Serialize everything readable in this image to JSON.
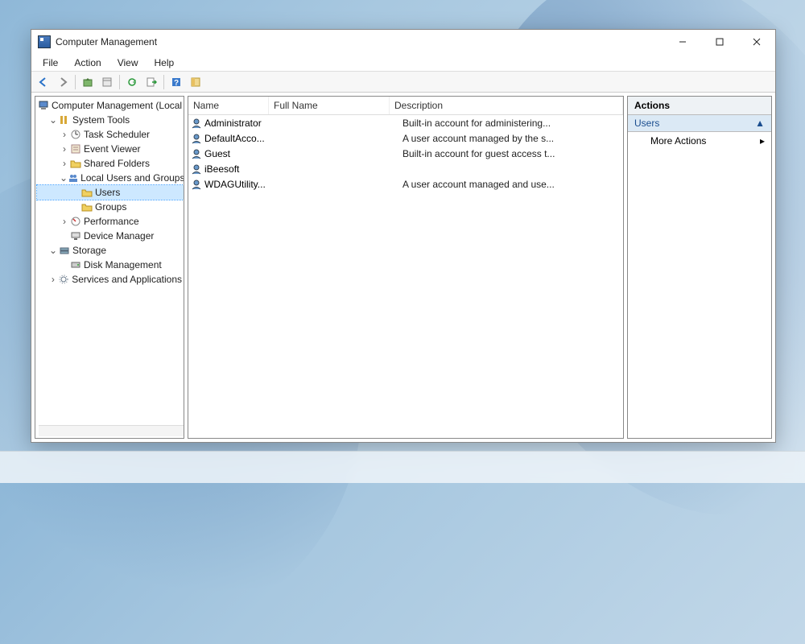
{
  "window": {
    "title": "Computer Management"
  },
  "menubar": [
    "File",
    "Action",
    "View",
    "Help"
  ],
  "tree": {
    "root": "Computer Management (Local",
    "system_tools": "System Tools",
    "task_scheduler": "Task Scheduler",
    "event_viewer": "Event Viewer",
    "shared_folders": "Shared Folders",
    "local_users_groups": "Local Users and Groups",
    "users": "Users",
    "groups": "Groups",
    "performance": "Performance",
    "device_manager": "Device Manager",
    "storage": "Storage",
    "disk_management": "Disk Management",
    "services_apps": "Services and Applications"
  },
  "list": {
    "columns": {
      "name": "Name",
      "fullname": "Full Name",
      "description": "Description"
    },
    "rows": [
      {
        "name": "Administrator",
        "fullname": "",
        "description": "Built-in account for administering..."
      },
      {
        "name": "DefaultAcco...",
        "fullname": "",
        "description": "A user account managed by the s..."
      },
      {
        "name": "Guest",
        "fullname": "",
        "description": "Built-in account for guest access t..."
      },
      {
        "name": "iBeesoft",
        "fullname": "",
        "description": ""
      },
      {
        "name": "WDAGUtility...",
        "fullname": "",
        "description": "A user account managed and use..."
      }
    ]
  },
  "actions": {
    "header": "Actions",
    "section": "Users",
    "more": "More Actions"
  }
}
